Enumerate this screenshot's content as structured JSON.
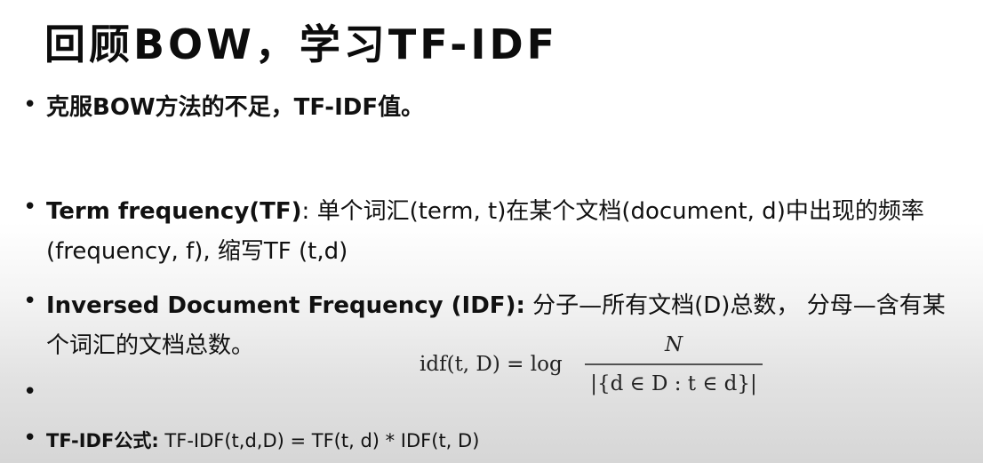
{
  "slide": {
    "title": "回顾BOW，学习TF-IDF",
    "bullet_symbol": "•",
    "bullets": {
      "bow": "克服BOW方法的不足，TF-IDF值。",
      "tf": {
        "term": "Term frequency(TF)",
        "text": ": 单个词汇(term, t)在某个文档(document, d)中出现的频率(frequency, f), 缩写TF (t,d)"
      },
      "idf": {
        "term": "Inversed Document Frequency (IDF):",
        "text": " 分子—所有文档(D)总数， 分母—含有某个词汇的文档总数。"
      },
      "empty": "",
      "formula": {
        "term": "TF-IDF公式:",
        "text": " TF-IDF(t,d,D) = TF(t, d) * IDF(t, D)"
      }
    },
    "idf_formula": {
      "lhs": "idf(t, D) = log",
      "numerator": "N",
      "denominator": "|{d ∈ D : t ∈ d}|"
    }
  }
}
